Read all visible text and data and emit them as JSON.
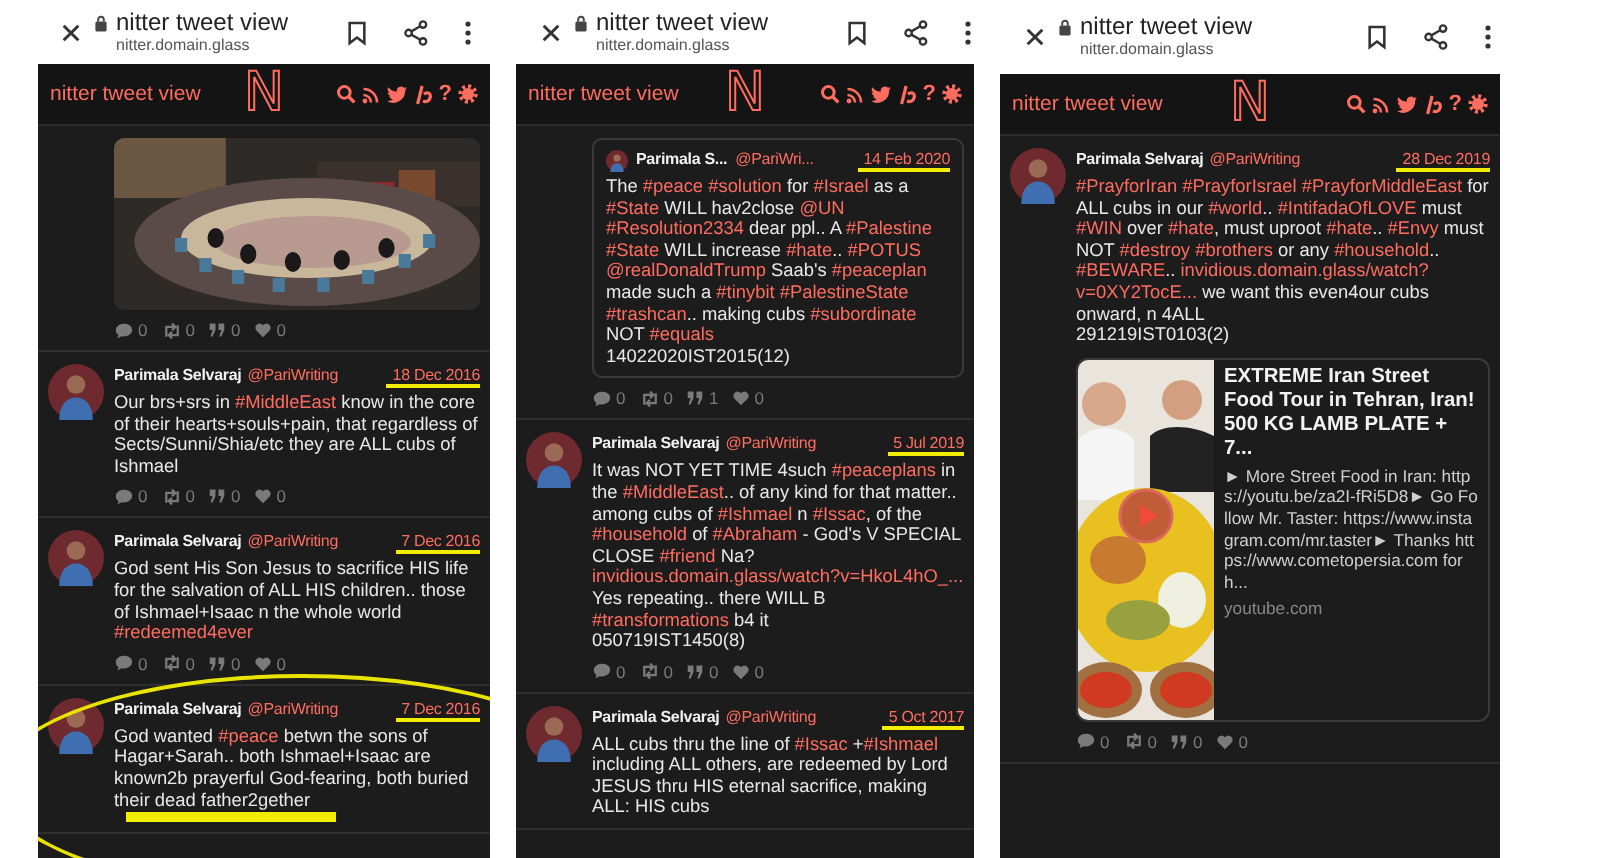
{
  "panels": [
    {
      "browser": {
        "title": "nitter tweet view",
        "url": "nitter.domain.glass"
      },
      "header": {
        "site_title": "nitter tweet view",
        "logo": "N",
        "help": "?"
      },
      "tweets": [
        {
          "kind": "continued",
          "media": {
            "kind": "picture"
          },
          "stats": [
            {
              "kind": "replies",
              "count": "0"
            },
            {
              "kind": "retweets",
              "count": "0"
            },
            {
              "kind": "quotes",
              "count": "0"
            },
            {
              "kind": "likes",
              "count": "0"
            }
          ]
        },
        {
          "kind": "tweet",
          "name": "Parimala Selvaraj",
          "handle": "@PariWriting",
          "date": "18 Dec 2016",
          "date_underlined": true,
          "body": [
            {
              "kind": "text",
              "text": "Our brs+srs in "
            },
            {
              "kind": "hashtag",
              "text": "#MiddleEast"
            },
            {
              "kind": "text",
              "text": " know in the core of their hearts+souls+pain, that regardless of Sects/Sunni/Shia/etc they are ALL cubs of Ishmael"
            }
          ],
          "stats": [
            {
              "kind": "replies",
              "count": "0"
            },
            {
              "kind": "retweets",
              "count": "0"
            },
            {
              "kind": "quotes",
              "count": "0"
            },
            {
              "kind": "likes",
              "count": "0"
            }
          ]
        },
        {
          "kind": "tweet",
          "name": "Parimala Selvaraj",
          "handle": "@PariWriting",
          "date": "7 Dec 2016",
          "date_underlined": true,
          "body": [
            {
              "kind": "text",
              "text": "God sent His Son Jesus to sacrifice HIS life for the salvation of ALL HIS children.. those of Ishmael+Isaac n the whole world "
            },
            {
              "kind": "hashtag",
              "text": "#redeemed4ever"
            }
          ],
          "stats": [
            {
              "kind": "replies",
              "count": "0"
            },
            {
              "kind": "retweets",
              "count": "0"
            },
            {
              "kind": "quotes",
              "count": "0"
            },
            {
              "kind": "likes",
              "count": "0"
            }
          ]
        },
        {
          "kind": "tweet",
          "name": "Parimala Selvaraj",
          "handle": "@PariWriting",
          "date": "7 Dec 2016",
          "date_underlined": true,
          "circled": true,
          "text_underlined": true,
          "body": [
            {
              "kind": "text",
              "text": "God wanted "
            },
            {
              "kind": "hashtag",
              "text": "#peace"
            },
            {
              "kind": "text",
              "text": " betwn the sons of Hagar+Sarah.. both Ishmael+Isaac are known2b prayerful God-fearing, both buried their dead father2gether"
            }
          ]
        }
      ]
    },
    {
      "browser": {
        "title": "nitter tweet view",
        "url": "nitter.domain.glass"
      },
      "header": {
        "site_title": "nitter tweet view",
        "logo": "N",
        "help": "?"
      },
      "tweets": [
        {
          "kind": "continued",
          "quote": {
            "name": "Parimala S...",
            "handle": "@PariWri...",
            "date": "14 Feb 2020",
            "date_underlined": true,
            "body": [
              {
                "kind": "text",
                "text": "The "
              },
              {
                "kind": "hashtag",
                "text": "#peace"
              },
              {
                "kind": "space"
              },
              {
                "kind": "hashtag",
                "text": "#solution"
              },
              {
                "kind": "text",
                "text": " for "
              },
              {
                "kind": "hashtag",
                "text": "#Israel"
              },
              {
                "kind": "text",
                "text": " as a "
              },
              {
                "kind": "hashtag",
                "text": "#State"
              },
              {
                "kind": "text",
                "text": " WILL hav2close "
              },
              {
                "kind": "mention",
                "text": "@UN"
              },
              {
                "kind": "space"
              },
              {
                "kind": "hashtag",
                "text": "#Resolution2334"
              },
              {
                "kind": "text",
                "text": " dear ppl.. A "
              },
              {
                "kind": "hashtag",
                "text": "#Palestine"
              },
              {
                "kind": "space"
              },
              {
                "kind": "hashtag",
                "text": "#State"
              },
              {
                "kind": "text",
                "text": " WILL increase "
              },
              {
                "kind": "hashtag",
                "text": "#hate"
              },
              {
                "kind": "text",
                "text": ".. "
              },
              {
                "kind": "hashtag",
                "text": "#POTUS"
              },
              {
                "kind": "space"
              },
              {
                "kind": "mention",
                "text": "@realDonaldTrump"
              },
              {
                "kind": "text",
                "text": " Saab's "
              },
              {
                "kind": "hashtag",
                "text": "#peaceplan"
              },
              {
                "kind": "text",
                "text": " made such a "
              },
              {
                "kind": "hashtag",
                "text": "#tinybit"
              },
              {
                "kind": "space"
              },
              {
                "kind": "hashtag",
                "text": "#PalestineState"
              },
              {
                "kind": "space"
              },
              {
                "kind": "hashtag",
                "text": "#trashcan"
              },
              {
                "kind": "text",
                "text": ".. making cubs "
              },
              {
                "kind": "hashtag",
                "text": "#subordinate"
              },
              {
                "kind": "text",
                "text": " NOT "
              },
              {
                "kind": "hashtag",
                "text": "#equals"
              },
              {
                "kind": "text",
                "text": "\n14022020IST2015(12)"
              }
            ]
          },
          "stats": [
            {
              "kind": "replies",
              "count": "0"
            },
            {
              "kind": "retweets",
              "count": "0"
            },
            {
              "kind": "quotes",
              "count": "1"
            },
            {
              "kind": "likes",
              "count": "0"
            }
          ]
        },
        {
          "kind": "tweet",
          "name": "Parimala Selvaraj",
          "handle": "@PariWriting",
          "date": "5 Jul 2019",
          "date_underlined": true,
          "body": [
            {
              "kind": "text",
              "text": "It was NOT YET TIME 4such "
            },
            {
              "kind": "hashtag",
              "text": "#peaceplans"
            },
            {
              "kind": "text",
              "text": " in the "
            },
            {
              "kind": "hashtag",
              "text": "#MiddleEast"
            },
            {
              "kind": "text",
              "text": ".. of any kind for that matter.. among cubs of "
            },
            {
              "kind": "hashtag",
              "text": "#Ishmael"
            },
            {
              "kind": "text",
              "text": " n "
            },
            {
              "kind": "hashtag",
              "text": "#Issac"
            },
            {
              "kind": "text",
              "text": ", of the "
            },
            {
              "kind": "hashtag",
              "text": "#household"
            },
            {
              "kind": "text",
              "text": " of "
            },
            {
              "kind": "hashtag",
              "text": "#Abraham"
            },
            {
              "kind": "text",
              "text": " - God's V SPECIAL CLOSE "
            },
            {
              "kind": "hashtag",
              "text": "#friend"
            },
            {
              "kind": "text",
              "text": " Na?\n"
            },
            {
              "kind": "url",
              "text": "invidious.domain.glass/"
            },
            {
              "kind": "url",
              "text": "watch?v=HkoL4hO_..."
            },
            {
              "kind": "text",
              "text": "\nYes repeating.. there WILL B\n"
            },
            {
              "kind": "hashtag",
              "text": "#transformations"
            },
            {
              "kind": "text",
              "text": " b4 it\n050719IST1450(8)"
            }
          ],
          "stats": [
            {
              "kind": "replies",
              "count": "0"
            },
            {
              "kind": "retweets",
              "count": "0"
            },
            {
              "kind": "quotes",
              "count": "0"
            },
            {
              "kind": "likes",
              "count": "0"
            }
          ]
        },
        {
          "kind": "tweet",
          "name": "Parimala Selvaraj",
          "handle": "@PariWriting",
          "date": "5 Oct 2017",
          "date_underlined": true,
          "body": [
            {
              "kind": "text",
              "text": "ALL cubs thru the line of "
            },
            {
              "kind": "hashtag",
              "text": "#Issac"
            },
            {
              "kind": "text",
              "text": " +"
            },
            {
              "kind": "hashtag",
              "text": "#Ishmael"
            },
            {
              "kind": "text",
              "text": " including ALL others, are redeemed by Lord JESUS thru HIS eternal sacrifice, making ALL: HIS cubs"
            }
          ]
        }
      ]
    },
    {
      "browser": {
        "title": "nitter tweet view",
        "url": "nitter.domain.glass"
      },
      "header": {
        "site_title": "nitter tweet view",
        "logo": "N",
        "help": "?"
      },
      "tweets": [
        {
          "kind": "tweet",
          "name": "Parimala Selvaraj",
          "handle": "@PariWriting",
          "date": "28 Dec 2019",
          "date_underlined": true,
          "body": [
            {
              "kind": "hashtag",
              "text": "#PrayforIran"
            },
            {
              "kind": "space"
            },
            {
              "kind": "hashtag",
              "text": "#PrayforIsrael"
            },
            {
              "kind": "space"
            },
            {
              "kind": "hashtag",
              "text": "#PrayforMiddleEast"
            },
            {
              "kind": "text",
              "text": " for ALL cubs in our "
            },
            {
              "kind": "hashtag",
              "text": "#world"
            },
            {
              "kind": "text",
              "text": ".. "
            },
            {
              "kind": "hashtag",
              "text": "#IntifadaOfLOVE"
            },
            {
              "kind": "text",
              "text": " must "
            },
            {
              "kind": "hashtag",
              "text": "#WIN"
            },
            {
              "kind": "text",
              "text": " over "
            },
            {
              "kind": "hashtag",
              "text": "#hate"
            },
            {
              "kind": "text",
              "text": ", must uproot "
            },
            {
              "kind": "hashtag",
              "text": "#hate"
            },
            {
              "kind": "text",
              "text": ".. "
            },
            {
              "kind": "hashtag",
              "text": "#Envy"
            },
            {
              "kind": "text",
              "text": " must NOT "
            },
            {
              "kind": "hashtag",
              "text": "#destroy"
            },
            {
              "kind": "space"
            },
            {
              "kind": "hashtag",
              "text": "#brothers"
            },
            {
              "kind": "text",
              "text": " or any "
            },
            {
              "kind": "hashtag",
              "text": "#household"
            },
            {
              "kind": "text",
              "text": ".. "
            },
            {
              "kind": "hashtag",
              "text": "#BEWARE"
            },
            {
              "kind": "text",
              "text": ".. "
            },
            {
              "kind": "url",
              "text": "invidious.domain.glass/watch?"
            },
            {
              "kind": "url",
              "text": "v=0XY2TocE..."
            },
            {
              "kind": "text",
              "text": " we want this even4our cubs onward, n 4ALL\n291219IST0103(2)"
            }
          ],
          "card": {
            "media": {
              "kind": "picture"
            },
            "title": "EXTREME Iran Street Food Tour in Tehran, Iran! 500 KG LAMB PLATE + 7...",
            "description": "► More Street Food in Iran: https://youtu.be/za2I-fRi5D8► Go Follow Mr. Taster: https://www.instagram.com/mr.taster► Thanks https://www.cometopersia.com for h...",
            "domain": "youtube.com"
          },
          "stats": [
            {
              "kind": "replies",
              "count": "0"
            },
            {
              "kind": "retweets",
              "count": "0"
            },
            {
              "kind": "quotes",
              "count": "0"
            },
            {
              "kind": "likes",
              "count": "0"
            }
          ]
        }
      ]
    }
  ]
}
